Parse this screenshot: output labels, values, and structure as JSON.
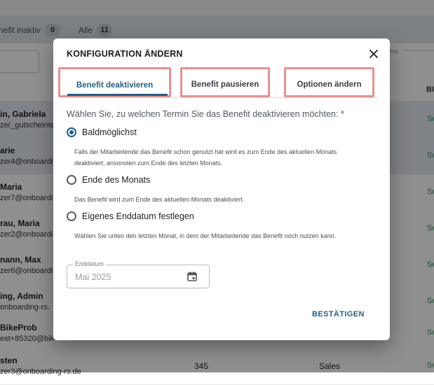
{
  "background": {
    "filters": [
      {
        "label": "nefit inaktiv",
        "count": "0"
      },
      {
        "label": "Alle",
        "count": "11"
      }
    ],
    "status_label": "tus",
    "column_header": "BI",
    "rows": [
      {
        "name": "in, Gabriela",
        "email": "zer_gutscheinte",
        "side": "Se",
        "number": "",
        "dept": ""
      },
      {
        "name": "arie",
        "email": "zer4@onboardin",
        "side": "Se",
        "number": "",
        "dept": ""
      },
      {
        "name": "Maria",
        "email": "zer7@onboardin",
        "side": "Se",
        "number": "",
        "dept": ""
      },
      {
        "name": "rau, Maria",
        "email": "zer2@onboardin",
        "side": "Se",
        "number": "",
        "dept": ""
      },
      {
        "name": "nann, Max",
        "email": "zer6@onboardin",
        "side": "Se",
        "number": "",
        "dept": ""
      },
      {
        "name": "ing, Admin",
        "email": "onboarding-rs.",
        "side": "Se",
        "number": "",
        "dept": ""
      },
      {
        "name": "BikeProb",
        "email": "est+85320@bik",
        "side": "Se",
        "number": "",
        "dept": ""
      },
      {
        "name": "sten",
        "email": "zer3@onboarding-rs.de",
        "side": "Se",
        "number": "345",
        "dept": "Sales"
      }
    ]
  },
  "dialog": {
    "title": "KONFIGURATION ÄNDERN",
    "tabs": [
      {
        "label": "Benefit deaktivieren",
        "active": true
      },
      {
        "label": "Benefit pausieren",
        "active": false
      },
      {
        "label": "Optionen ändern",
        "active": false
      }
    ],
    "question": "Wählen Sie, zu welchen Termin Sie das Benefit deaktivieren möchten: *",
    "options": [
      {
        "label": "Baldmöglichst",
        "selected": true,
        "hint": "Falls der Mitarbeitende das Benefit schon genutzt hat wird es zum Ende des aktuellen Monats deaktiviert, ansonsten zum Ende des letzten Monats."
      },
      {
        "label": "Ende des Monats",
        "selected": false,
        "hint": "Das Benefit wird zum Ende des aktuellen Monats deaktiviert."
      },
      {
        "label": "Eigenes Enddatum festlegen",
        "selected": false,
        "hint": "Wählen Sie unten den letzten Monat, in dem der Mitarbeitende das Benefit noch nutzen kann."
      }
    ],
    "end_date": {
      "label": "Enddatum",
      "placeholder": "Mai 2025",
      "icon": "calendar-icon"
    },
    "confirm_label": "BESTÄTIGEN"
  },
  "colors": {
    "accent": "#1c5f8a",
    "highlight_box": "#ea8f8f",
    "overlay": "rgba(0,0,0,0.44)",
    "green_text": "#2e8b57"
  }
}
